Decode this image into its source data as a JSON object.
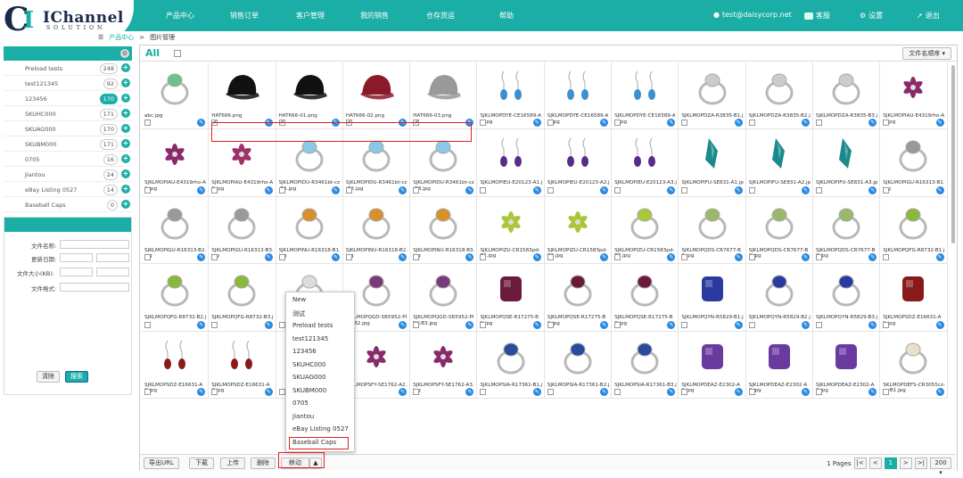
{
  "header": {
    "logo_text": "IChannel",
    "logo_sub": "SOLUTION",
    "nav": [
      "产品中心",
      "销售订单",
      "客户管理",
      "我的销售",
      "仓存货运",
      "帮助"
    ],
    "user_email": "test@daisycorp.net",
    "service_label": "客服",
    "settings_label": "设置",
    "logout_label": "退出"
  },
  "breadcrumb": {
    "parent": "产品中心",
    "sep": ">",
    "current": "图片管理"
  },
  "folders": [
    {
      "name": "Preload tests",
      "count": "248"
    },
    {
      "name": "test121345",
      "count": "92"
    },
    {
      "name": "123456",
      "count": "170",
      "selected": true
    },
    {
      "name": "SKUHC000",
      "count": "171"
    },
    {
      "name": "SKUAG000",
      "count": "170"
    },
    {
      "name": "SKUBM000",
      "count": "171"
    },
    {
      "name": "0705",
      "count": "16"
    },
    {
      "name": "Jiantou",
      "count": "24"
    },
    {
      "name": "eBay Listing 0527",
      "count": "14"
    },
    {
      "name": "Baseball Caps",
      "count": "0"
    }
  ],
  "search": {
    "name_label": "文件名称:",
    "date_label": "更新日期:",
    "size_label": "文件大小(KB):",
    "format_label": "文件格式:",
    "clear_label": "清除",
    "search_label": "搜索"
  },
  "main": {
    "all_label": "All",
    "sort_label": "文件名顺序 ▾"
  },
  "images": [
    {
      "name": "abc.jpg",
      "kind": "ring",
      "color": "#6fbf8f"
    },
    {
      "name": "HAT666.png",
      "kind": "hat",
      "color": "#111111",
      "checked": true
    },
    {
      "name": "HAT666-01.png",
      "kind": "hat",
      "color": "#111111",
      "checked": true
    },
    {
      "name": "HAT666-02.png",
      "kind": "hat",
      "color": "#8a1a2a",
      "checked": true
    },
    {
      "name": "HAT666-03.png",
      "kind": "hat",
      "color": "#999999",
      "checked": true
    },
    {
      "name": "SJKLMOPDYE-CE16589-A1.jpg",
      "kind": "earring",
      "color": "#3a8fd0"
    },
    {
      "name": "SJKLMOPDYE-CE16589-A2.jpg",
      "kind": "earring",
      "color": "#3a8fd0"
    },
    {
      "name": "SJKLMOPDYE-CE16589-A3.jpg",
      "kind": "earring",
      "color": "#3a8fd0"
    },
    {
      "name": "SJKLMOPDZA-R3835-B1.jpg",
      "kind": "ring",
      "color": "#cccccc"
    },
    {
      "name": "SJKLMOPDZA-R3835-B2.jpg",
      "kind": "ring",
      "color": "#cccccc"
    },
    {
      "name": "SJKLMOPDZA-R3835-B3.jpg",
      "kind": "ring",
      "color": "#cccccc"
    },
    {
      "name": "SJKLMOPIAU-E4319rho-A1.jpg",
      "kind": "flower",
      "color": "#8a2a6a"
    },
    {
      "name": "SJKLMOPIAU-E4319rho-A2.jpg",
      "kind": "flower",
      "color": "#8a2a6a"
    },
    {
      "name": "SJKLMOPIAU-E4319rho-A3.jpg",
      "kind": "flower",
      "color": "#a0306a"
    },
    {
      "name": "SJKLMOPIDU-R3461bt-cz-B1.jpg",
      "kind": "ring",
      "color": "#8ac8e8"
    },
    {
      "name": "SJKLMOPIDU-R3461bt-cz-B2.jpg",
      "kind": "ring",
      "color": "#8ac8e8"
    },
    {
      "name": "SJKLMOPIDU-R3461bt-cz-B3.jpg",
      "kind": "ring",
      "color": "#8ac8e8"
    },
    {
      "name": "SJKLMOPIEU-E20123-A1.jpg",
      "kind": "earring",
      "color": "#5a2a8a"
    },
    {
      "name": "SJKLMOPIEU-E20123-A2.jpg",
      "kind": "earring",
      "color": "#5a2a8a"
    },
    {
      "name": "SJKLMOPIEU-E20123-A3.jpg",
      "kind": "earring",
      "color": "#5a2a8a"
    },
    {
      "name": "SJKLMOPIFU-SE831-A1.jpg",
      "kind": "drop",
      "color": "#1a8a8a"
    },
    {
      "name": "SJKLMOPIFU-SE831-A2.jpg",
      "kind": "drop",
      "color": "#1a8a8a"
    },
    {
      "name": "SJKLMOPIFU-SE831-A3.jpg",
      "kind": "drop",
      "color": "#1a8a8a"
    },
    {
      "name": "SJKLMOPIGU-R16313-B1.jpg",
      "kind": "ring",
      "color": "#999999"
    },
    {
      "name": "SJKLMOPIGU-R16313-B2.jpg",
      "kind": "ring",
      "color": "#999999"
    },
    {
      "name": "SJKLMOPIGU-R16313-B3.jpg",
      "kind": "ring",
      "color": "#999999"
    },
    {
      "name": "SJKLMOPINU-R16318-B1.jpg",
      "kind": "ring",
      "color": "#d8902a"
    },
    {
      "name": "SJKLMOPINU-R16318-B2.jpg",
      "kind": "ring",
      "color": "#d8902a"
    },
    {
      "name": "SJKLMOPINU-R16318-B3.jpg",
      "kind": "ring",
      "color": "#d8902a"
    },
    {
      "name": "SJKLMOPIZU-CR1583pd-B1.jpg",
      "kind": "flower",
      "color": "#a8c83a"
    },
    {
      "name": "SJKLMOPIZU-CR1583pd-B2.jpg",
      "kind": "flower",
      "color": "#a8c83a"
    },
    {
      "name": "SJKLMOPIZU-CR1583pd-B3.jpg",
      "kind": "ring",
      "color": "#a8c83a"
    },
    {
      "name": "SJKLMOPQDS-CR7677-B1.jpg",
      "kind": "ring",
      "color": "#9ab86a"
    },
    {
      "name": "SJKLMOPQDS-CR7677-B2.jpg",
      "kind": "ring",
      "color": "#9ab86a"
    },
    {
      "name": "SJKLMOPQDS-CR7677-B3.jpg",
      "kind": "ring",
      "color": "#9ab86a"
    },
    {
      "name": "SJKLMOPQFG-R8732-B1.jpg",
      "kind": "ring",
      "color": "#8ab83a"
    },
    {
      "name": "SJKLMOPQFG-R8732-B2.jpg",
      "kind": "ring",
      "color": "#8ab83a"
    },
    {
      "name": "SJKLMOPQFG-R8732-B3.jpg",
      "kind": "ring",
      "color": "#8ab83a"
    },
    {
      "name": "",
      "kind": "ring",
      "color": "#dddddd"
    },
    {
      "name": "SJKLMOPQGD-SR5952-PINK-B2.jpg",
      "kind": "ring",
      "color": "#7a3a7a"
    },
    {
      "name": "SJKLMOPQGD-SR5952-PINK-B3.jpg",
      "kind": "ring",
      "color": "#7a3a7a"
    },
    {
      "name": "SJKLMOPQSE-R17275-B1.jpg",
      "kind": "gem",
      "color": "#6a1a3a"
    },
    {
      "name": "SJKLMOPQSE-R17275-B2.jpg",
      "kind": "ring",
      "color": "#6a1a3a"
    },
    {
      "name": "SJKLMOPQSE-R17275-B3.jpg",
      "kind": "ring",
      "color": "#6a1a3a"
    },
    {
      "name": "SJKLMOPQYN-R5829-B1.jpg",
      "kind": "gem",
      "color": "#2a3aa0"
    },
    {
      "name": "SJKLMOPQYN-R5829-B2.jpg",
      "kind": "ring",
      "color": "#2a3aa0"
    },
    {
      "name": "SJKLMOPQYN-R5829-B3.jpg",
      "kind": "ring",
      "color": "#2a3aa0"
    },
    {
      "name": "SJKLMOPSDZ-E16631-A1.jpg",
      "kind": "gem",
      "color": "#8a1a1a"
    },
    {
      "name": "SJKLMOPSDZ-E16631-A2.jpg",
      "kind": "earring",
      "color": "#8a1a1a"
    },
    {
      "name": "SJKLMOPSDZ-E16631-A3.jpg",
      "kind": "earring",
      "color": "#8a1a1a"
    },
    {
      "name": "",
      "kind": "earring",
      "color": "#8a2a6a"
    },
    {
      "name": "SJKLMOPSFY-SE1762-A2.jpg",
      "kind": "flower",
      "color": "#8a2a6a"
    },
    {
      "name": "SJKLMOPSFY-SE1762-A3.jpg",
      "kind": "flower",
      "color": "#8a2a6a"
    },
    {
      "name": "SJKLMOPSIA-R17361-B1.jpg",
      "kind": "ring",
      "color": "#2a4aa0"
    },
    {
      "name": "SJKLMOPSIA-R17361-B2.jpg",
      "kind": "ring",
      "color": "#2a4aa0"
    },
    {
      "name": "SJKLMOPSIA-R17361-B3.jpg",
      "kind": "ring",
      "color": "#2a4aa0"
    },
    {
      "name": "SJKLMOPDEAZ-E2302-A1.jpg",
      "kind": "gem",
      "color": "#6a3aa0"
    },
    {
      "name": "SJKLMOPDEAZ-E2302-A2.jpg",
      "kind": "gem",
      "color": "#6a3aa0"
    },
    {
      "name": "SJKLMOPDEAZ-E2302-A3.jpg",
      "kind": "gem",
      "color": "#6a3aa0"
    },
    {
      "name": "SKLMOPDEFS-CR3055cz-ss-B1.jpg",
      "kind": "ring",
      "color": "#e8e0c8"
    }
  ],
  "menu": {
    "items": [
      "New",
      "测试",
      "Preload tests",
      "test121345",
      "123456",
      "SKUHC000",
      "SKUAG000",
      "SKUBM000",
      "0705",
      "Jiantou",
      "eBay Listing 0527",
      "Baseball Caps"
    ]
  },
  "bottom": {
    "export_label": "导出URL",
    "download_label": "下载",
    "upload_label": "上传",
    "delete_label": "删除",
    "move_label": "移动",
    "pages_label": "1 Pages",
    "page": "1",
    "per_page": "200 ▾"
  },
  "colors": {
    "accent": "#1aaea6",
    "highlight": "#e02020"
  }
}
